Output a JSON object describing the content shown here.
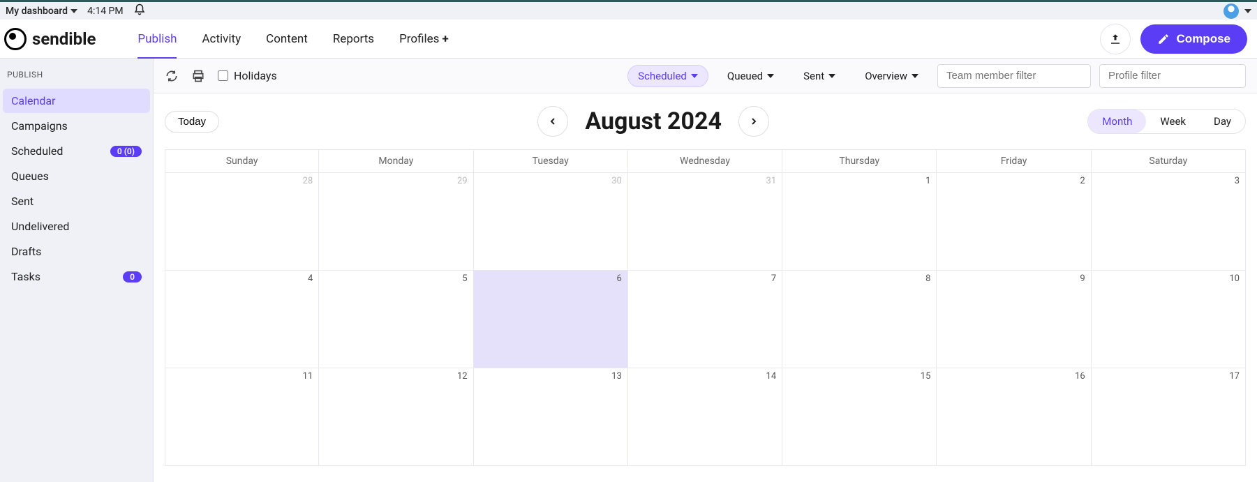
{
  "topbar": {
    "dashboard_label": "My dashboard",
    "time": "4:14 PM"
  },
  "brand": "sendible",
  "nav": {
    "publish": "Publish",
    "activity": "Activity",
    "content": "Content",
    "reports": "Reports",
    "profiles": "Profiles"
  },
  "header": {
    "compose": "Compose"
  },
  "sidebar": {
    "title": "PUBLISH",
    "items": [
      {
        "label": "Calendar"
      },
      {
        "label": "Campaigns"
      },
      {
        "label": "Scheduled",
        "badge": "0 (0)"
      },
      {
        "label": "Queues"
      },
      {
        "label": "Sent"
      },
      {
        "label": "Undelivered"
      },
      {
        "label": "Drafts"
      },
      {
        "label": "Tasks",
        "badge": "0"
      }
    ]
  },
  "toolbar": {
    "holidays": "Holidays",
    "scheduled": "Scheduled",
    "queued": "Queued",
    "sent": "Sent",
    "overview": "Overview",
    "team_placeholder": "Team member filter",
    "profile_placeholder": "Profile filter"
  },
  "calendar": {
    "today": "Today",
    "title": "August 2024",
    "views": {
      "month": "Month",
      "week": "Week",
      "day": "Day"
    },
    "dow": [
      "Sunday",
      "Monday",
      "Tuesday",
      "Wednesday",
      "Thursday",
      "Friday",
      "Saturday"
    ],
    "cells": [
      {
        "n": "28",
        "prev": true
      },
      {
        "n": "29",
        "prev": true
      },
      {
        "n": "30",
        "prev": true
      },
      {
        "n": "31",
        "prev": true
      },
      {
        "n": "1"
      },
      {
        "n": "2"
      },
      {
        "n": "3"
      },
      {
        "n": "4"
      },
      {
        "n": "5"
      },
      {
        "n": "6",
        "today": true
      },
      {
        "n": "7"
      },
      {
        "n": "8"
      },
      {
        "n": "9"
      },
      {
        "n": "10"
      },
      {
        "n": "11"
      },
      {
        "n": "12"
      },
      {
        "n": "13"
      },
      {
        "n": "14"
      },
      {
        "n": "15"
      },
      {
        "n": "16"
      },
      {
        "n": "17"
      }
    ]
  }
}
